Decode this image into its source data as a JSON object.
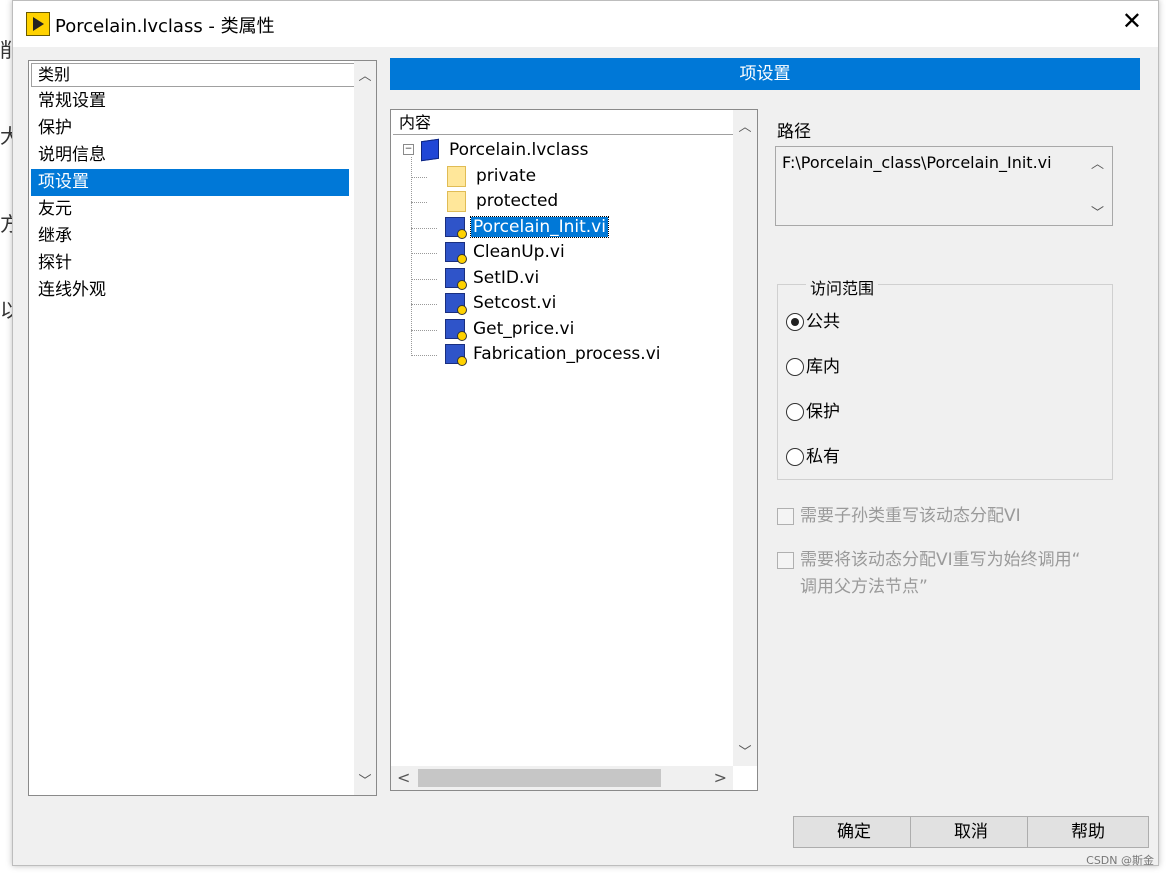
{
  "background_fragments": [
    "削",
    "大",
    "方",
    "以"
  ],
  "window": {
    "title": "Porcelain.lvclass  - 类属性",
    "close_glyph": "✕"
  },
  "categories": {
    "header": "类别",
    "items": [
      {
        "label": "常规设置",
        "selected": false
      },
      {
        "label": "保护",
        "selected": false
      },
      {
        "label": "说明信息",
        "selected": false
      },
      {
        "label": "项设置",
        "selected": true
      },
      {
        "label": "友元",
        "selected": false
      },
      {
        "label": "继承",
        "selected": false
      },
      {
        "label": "探针",
        "selected": false
      },
      {
        "label": "连线外观",
        "selected": false
      }
    ]
  },
  "section_header": "项设置",
  "contents": {
    "header": "内容",
    "root": "Porcelain.lvclass",
    "folders": [
      "private",
      "protected"
    ],
    "vis": [
      "Porcelain_Init.vi",
      "CleanUp.vi",
      "SetID.vi",
      "Setcost.vi",
      "Get_price.vi",
      "Fabrication_process.vi"
    ],
    "selected": "Porcelain_Init.vi"
  },
  "path": {
    "label": "路径",
    "value": "F:\\Porcelain_class\\Porcelain_Init.vi"
  },
  "access_scope": {
    "title": "访问范围",
    "options": [
      {
        "label": "公共",
        "checked": true
      },
      {
        "label": "库内",
        "checked": false
      },
      {
        "label": "保护",
        "checked": false
      },
      {
        "label": "私有",
        "checked": false
      }
    ]
  },
  "checkboxes": {
    "override_required": "需要子孙类重写该动态分配VI",
    "always_call_parent_line1": "需要将该动态分配VI重写为始终调用“",
    "always_call_parent_line2": "调用父方法节点”"
  },
  "buttons": {
    "ok": "确定",
    "cancel": "取消",
    "help": "帮助"
  },
  "watermark": "CSDN @斯金"
}
